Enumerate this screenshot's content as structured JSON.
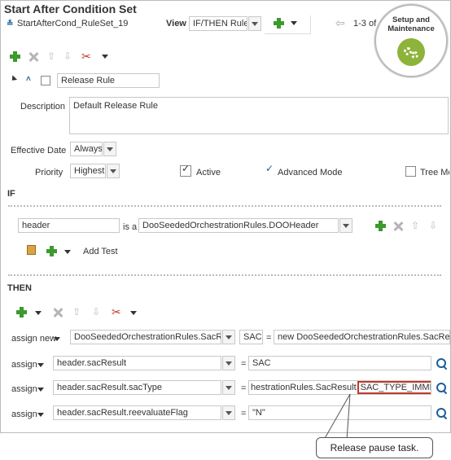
{
  "header": {
    "title": "Start After Condition Set",
    "ruleset_name": "StartAfterCond_RuleSet_19",
    "view_label": "View",
    "view_value": "IF/THEN Rules",
    "paging": "1-3 of"
  },
  "badge": {
    "label": "Setup and Maintenance"
  },
  "rule": {
    "name": "Release Rule",
    "description_label": "Description",
    "description_value": "Default Release Rule",
    "effective_date_label": "Effective Date",
    "effective_date_value": "Always",
    "priority_label": "Priority",
    "priority_value": "Highest",
    "active_label": "Active",
    "advanced_mode_label": "Advanced Mode",
    "tree_mode_label": "Tree Mo"
  },
  "if_section": {
    "label": "IF",
    "var": "header",
    "is_a": "is a",
    "type": "DooSeededOrchestrationRules.DOOHeader",
    "add_test": "Add Test"
  },
  "then_section": {
    "label": "THEN",
    "rows": [
      {
        "action": "assign new",
        "target": "DooSeededOrchestrationRules.SacResult",
        "var": "SAC",
        "op": "=",
        "value": "new DooSeededOrchestrationRules.SacResult()"
      },
      {
        "action": "assign",
        "target": "header.sacResult",
        "op": "=",
        "value": "SAC"
      },
      {
        "action": "assign",
        "target": "header.sacResult.sacType",
        "op": "=",
        "value": "hestrationRules.SacResult",
        "value_highlight": "SAC_TYPE_IMMEDIATE"
      },
      {
        "action": "assign",
        "target": "header.sacResult.reevaluateFlag",
        "op": "=",
        "value": "\"N\""
      }
    ]
  },
  "callout": {
    "text": "Release pause task."
  },
  "colors": {
    "highlight": "#c0392b",
    "badge_green": "#8db33a",
    "plus_green": "#3c9a2e",
    "link_blue": "#1a5d9c"
  }
}
